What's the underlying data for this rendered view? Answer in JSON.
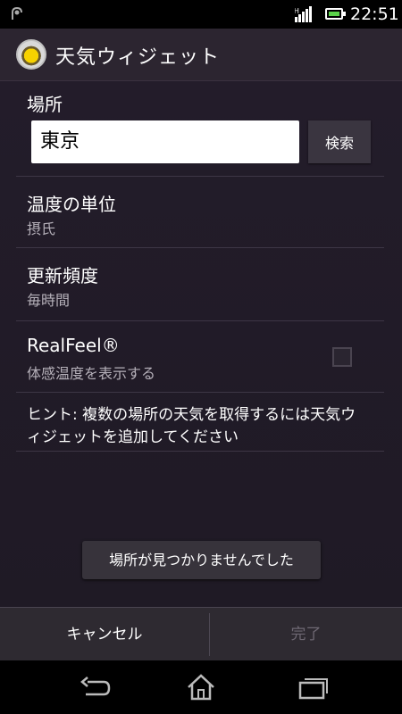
{
  "status_bar": {
    "time": "22:51"
  },
  "app": {
    "title": "天気ウィジェット"
  },
  "location": {
    "label": "場所",
    "value": "東京",
    "search_button": "検索"
  },
  "temperature_unit": {
    "title": "温度の単位",
    "value": "摂氏"
  },
  "update_frequency": {
    "title": "更新頻度",
    "value": "毎時間"
  },
  "realfeel": {
    "title": "RealFeel®",
    "subtitle": "体感温度を表示する"
  },
  "hint": "ヒント: 複数の場所の天気を取得するには天気ウィジェットを追加してください",
  "toast": "場所が見つかりませんでした",
  "bottom_buttons": {
    "cancel": "キャンセル",
    "done": "完了"
  },
  "colors": {
    "done_disabled": "#6e6873",
    "accent": "#f7d200"
  }
}
